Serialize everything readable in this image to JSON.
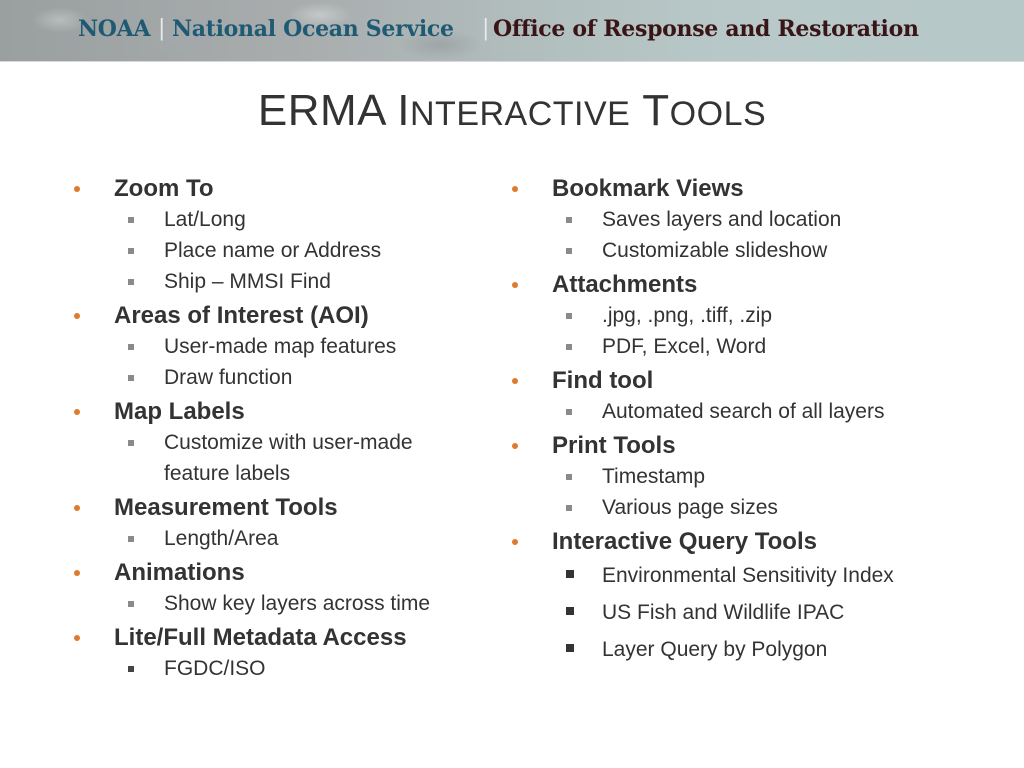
{
  "banner": {
    "org": "NOAA",
    "separator": "|",
    "service": "National Ocean Service",
    "office": "Office of Response and Restoration"
  },
  "title": {
    "main_first": "ERMA I",
    "main_sc1": "NTERACTIVE",
    "main_mid": " T",
    "main_sc2": "OOLS"
  },
  "left_column": [
    {
      "label": "Zoom To",
      "items": [
        "Lat/Long",
        "Place name or Address",
        "Ship – MMSI Find"
      ]
    },
    {
      "label": "Areas of Interest (AOI)",
      "items": [
        "User-made map features",
        "Draw function"
      ]
    },
    {
      "label": "Map Labels",
      "items": [
        "Customize with user-made",
        "feature labels"
      ]
    },
    {
      "label": "Measurement Tools",
      "items": [
        "Length/Area"
      ]
    },
    {
      "label": "Animations",
      "items": [
        "Show key layers across time"
      ]
    },
    {
      "label": "Lite/Full Metadata Access",
      "items": [
        "FGDC/ISO"
      ]
    }
  ],
  "right_column": [
    {
      "label": "Bookmark Views",
      "items": [
        "Saves layers and location",
        "Customizable slideshow"
      ]
    },
    {
      "label": "Attachments",
      "items": [
        ".jpg, .png, .tiff, .zip",
        "PDF, Excel, Word"
      ]
    },
    {
      "label": "Find tool",
      "items": [
        "Automated search of all layers"
      ]
    },
    {
      "label": "Print Tools",
      "items": [
        "Timestamp",
        "Various page sizes"
      ]
    },
    {
      "label": "Interactive Query Tools",
      "items": [
        "Environmental Sensitivity Index",
        "US Fish and Wildlife IPAC",
        "Layer Query by Polygon"
      ]
    }
  ],
  "colors": {
    "bullet": "#e07a2e",
    "text": "#333333",
    "noaa_blue": "#1f5a74",
    "office_maroon": "#3a1518"
  }
}
